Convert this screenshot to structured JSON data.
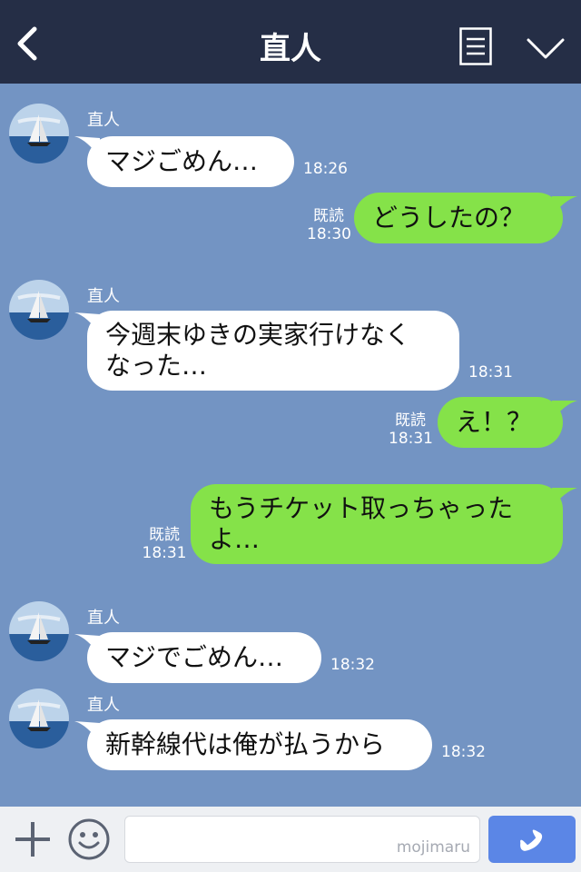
{
  "header": {
    "title": "直人",
    "back_icon": "back-icon",
    "menu_icon": "menu-icon",
    "collapse_icon": "chevron-down-icon"
  },
  "messages": [
    {
      "sender": "直人",
      "text": "マジごめん…",
      "time": "18:26",
      "direction": "in"
    },
    {
      "text": "どうしたの？",
      "read": "既読",
      "time": "18:30",
      "direction": "out"
    },
    {
      "sender": "直人",
      "text": "今週末ゆきの実家行けなく\nなった…",
      "time": "18:31",
      "direction": "in"
    },
    {
      "text": "え！？",
      "read": "既読",
      "time": "18:31",
      "direction": "out"
    },
    {
      "text": "もうチケット取っちゃった\nよ…",
      "read": "既読",
      "time": "18:31",
      "direction": "out"
    },
    {
      "sender": "直人",
      "text": "マジでごめん…",
      "time": "18:32",
      "direction": "in"
    },
    {
      "sender": "直人",
      "text": "新幹線代は俺が払うから",
      "time": "18:32",
      "direction": "in"
    }
  ],
  "footer": {
    "watermark": "mojimaru",
    "plus_icon": "plus-icon",
    "emoji_icon": "smiley-icon",
    "call_icon": "phone-icon"
  },
  "colors": {
    "header_bg": "#252e46",
    "chat_bg": "#7394c3",
    "incoming_bubble": "#ffffff",
    "outgoing_bubble": "#85e249",
    "call_button": "#5b86e6"
  }
}
